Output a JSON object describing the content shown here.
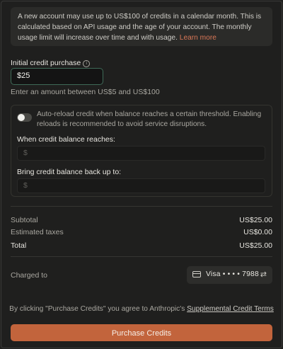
{
  "info": {
    "text": "A new account may use up to US$100 of credits in a calendar month. This is calculated based on API usage and the age of your account. The monthly usage limit will increase over time and with usage.",
    "link": "Learn more"
  },
  "credit": {
    "label": "Initial credit purchase",
    "info_icon": "info-icon",
    "value": "$25",
    "hint": "Enter an amount between US$5 and US$100"
  },
  "auto_reload": {
    "enabled": false,
    "description": "Auto-reload credit when balance reaches a certain threshold. Enabling reloads is recommended to avoid service disruptions.",
    "threshold_label": "When credit balance reaches:",
    "threshold_placeholder": "$",
    "target_label": "Bring credit balance back up to:",
    "target_placeholder": "$"
  },
  "summary": {
    "subtotal_label": "Subtotal",
    "subtotal_value": "US$25.00",
    "taxes_label": "Estimated taxes",
    "taxes_value": "US$0.00",
    "total_label": "Total",
    "total_value": "US$25.00"
  },
  "payment": {
    "label": "Charged to",
    "card": "Visa • • • • 7988",
    "card_icon": "credit-card-icon",
    "swap_icon": "swap-icon"
  },
  "terms": {
    "prefix": "By clicking \"Purchase Credits\" you agree to Anthropic's ",
    "link": "Supplemental Credit Terms"
  },
  "button": {
    "label": "Purchase Credits"
  },
  "colors": {
    "accent": "#c2643c",
    "link": "#d97757",
    "input_border": "#3e6a57"
  }
}
